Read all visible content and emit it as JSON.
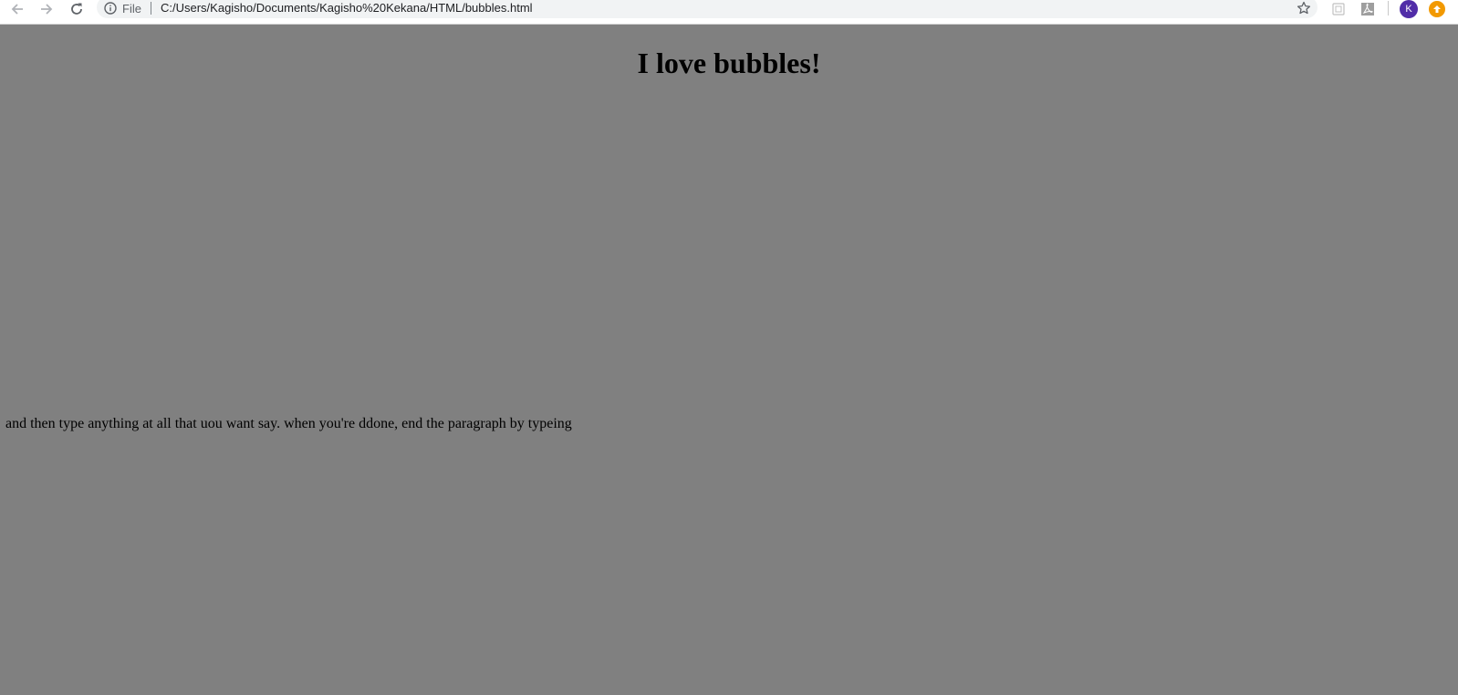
{
  "browser": {
    "site_info_label": "File",
    "url": "C:/Users/Kagisho/Documents/Kagisho%20Kekana/HTML/bubbles.html",
    "profile_initial": "K",
    "icons": {
      "back": "arrow-left-icon",
      "forward": "arrow-right-icon",
      "reload": "reload-icon",
      "site_info": "info-icon",
      "bookmark": "star-icon",
      "extension_1": "document-extension-icon",
      "extension_2": "acrobat-extension-icon",
      "update": "update-arrow-icon"
    },
    "colors": {
      "avatar": "#512da8",
      "update_badge": "#f29900",
      "omnibox": "#f1f3f4"
    }
  },
  "page": {
    "background": "#808080",
    "heading": "I love bubbles!",
    "paragraph": "and then type anything at all that uou want say. when you're ddone, end the paragraph by typeing"
  }
}
